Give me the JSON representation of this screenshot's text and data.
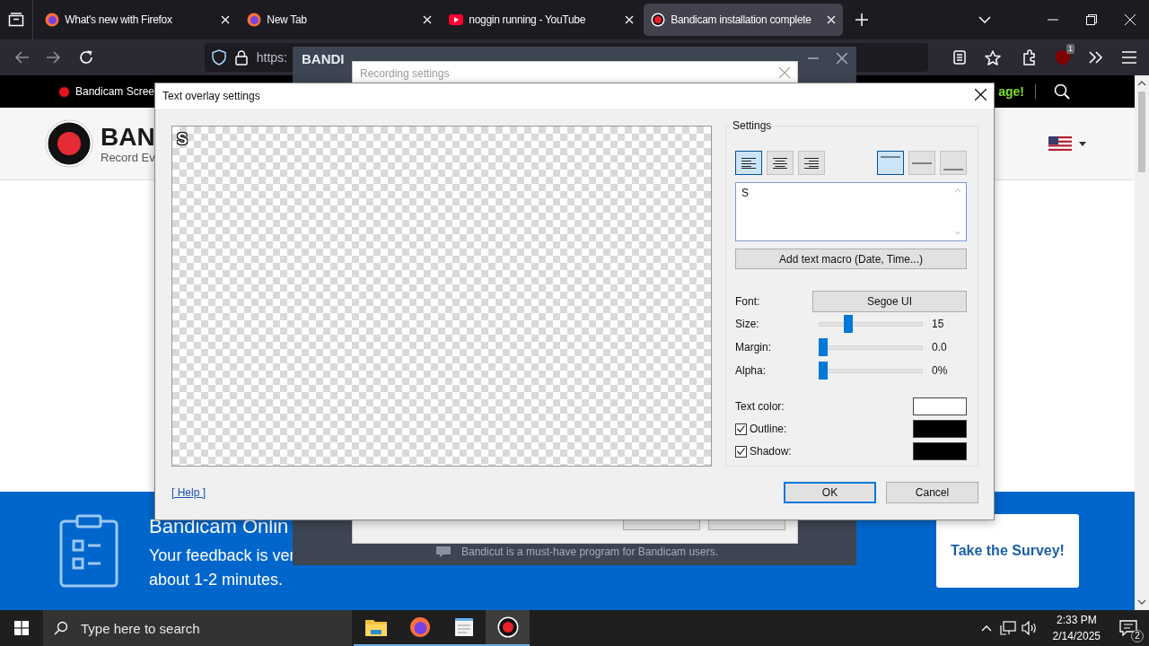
{
  "browser": {
    "tabs": [
      {
        "title": "What's new with Firefox",
        "kind": "firefox",
        "selected": false
      },
      {
        "title": "New Tab",
        "kind": "firefox",
        "selected": false
      },
      {
        "title": "noggin running - YouTube",
        "kind": "youtube",
        "selected": false
      },
      {
        "title": "Bandicam installation complete",
        "kind": "bandicam",
        "selected": true
      }
    ],
    "url": "https:",
    "extension_badge": "1"
  },
  "page": {
    "topbar_link": "Bandicam Scree",
    "topbar_promo": "age!",
    "logo_text": "BAN",
    "logo_tagline": "Record Ev",
    "banner": {
      "title": "Bandicam Onlin",
      "lines": [
        "Your feedback is ver",
        "about 1-2 minutes."
      ],
      "button": "Take the Survey!"
    }
  },
  "bandicam_window": {
    "brand": "BANDI",
    "footer": "Bandicut is a must-have program for Bandicam users."
  },
  "recording_dialog": {
    "title": "Recording settings"
  },
  "overlay_dialog": {
    "title": "Text overlay settings",
    "preview_text": "S",
    "settings_label": "Settings",
    "h_align": [
      {
        "kind": "left",
        "selected": true
      },
      {
        "kind": "center",
        "selected": false
      },
      {
        "kind": "right",
        "selected": false
      }
    ],
    "v_align": [
      {
        "kind": "top",
        "selected": true
      },
      {
        "kind": "middle",
        "selected": false
      },
      {
        "kind": "bottom",
        "selected": false
      }
    ],
    "text": "S",
    "macro_button": "Add text macro (Date, Time...)",
    "font": {
      "label": "Font:",
      "value": "Segoe UI"
    },
    "sliders": [
      {
        "label": "Size:",
        "level": 0.24,
        "reading": "15"
      },
      {
        "label": "Margin:",
        "level": 0,
        "reading": "0.0"
      },
      {
        "label": "Alpha:",
        "level": 0,
        "reading": "0%"
      }
    ],
    "colors": [
      {
        "label": "Text color:",
        "kind": "plain",
        "color": "#ffffff"
      },
      {
        "label": "Outline:",
        "kind": "checkbox",
        "checked": true,
        "color": "#000000"
      },
      {
        "label": "Shadow:",
        "kind": "checkbox",
        "checked": true,
        "color": "#000000"
      }
    ],
    "help": "[ Help ]",
    "buttons": [
      {
        "label": "OK",
        "focused": true
      },
      {
        "label": "Cancel",
        "focused": false
      }
    ]
  },
  "taskbar": {
    "search_placeholder": "Type here to search",
    "apps": [
      {
        "kind": "explorer",
        "selected": false
      },
      {
        "kind": "firefox",
        "selected": false
      },
      {
        "kind": "notepad",
        "selected": false
      },
      {
        "kind": "bandicam",
        "selected": true
      }
    ],
    "time": "2:33 PM",
    "date": "2/14/2025",
    "notifications": "2"
  }
}
